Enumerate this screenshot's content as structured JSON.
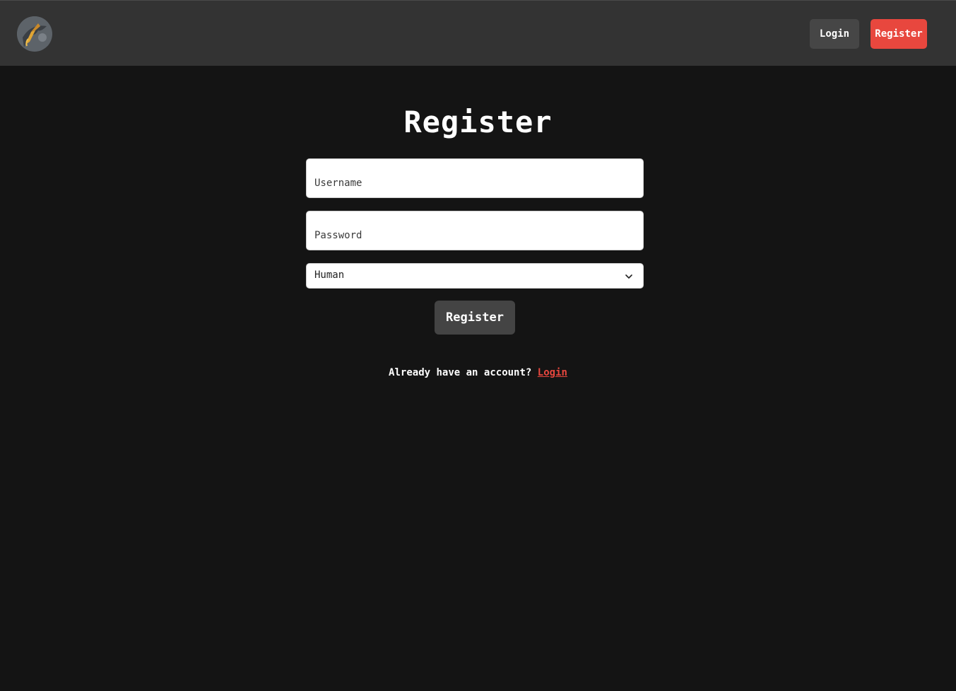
{
  "header": {
    "logo_icon": "dragon-logo-icon",
    "login_label": "Login",
    "register_label": "Register"
  },
  "form": {
    "title": "Register",
    "username_placeholder": "Username",
    "password_placeholder": "Password",
    "species_selected": "Human",
    "submit_label": "Register"
  },
  "footer": {
    "prompt": "Already have an account?",
    "login_link": "Login"
  },
  "colors": {
    "page_bg": "#141414",
    "header_bg": "#333333",
    "accent": "#e8473e",
    "button_dark": "#444444"
  }
}
